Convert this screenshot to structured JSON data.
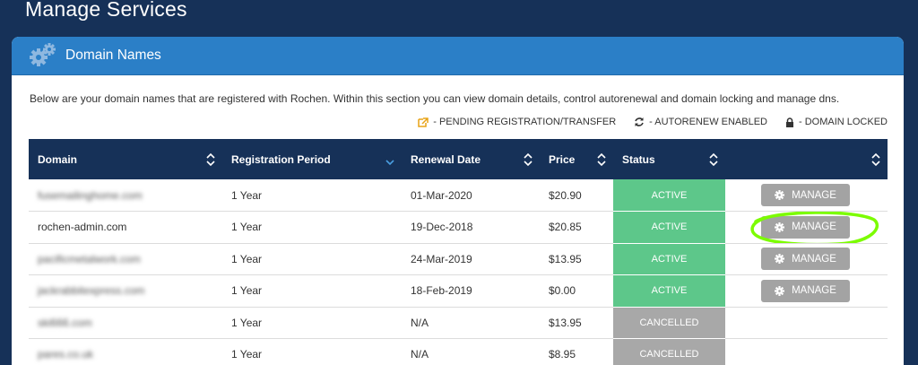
{
  "page": {
    "title": "Manage Services"
  },
  "panel": {
    "title": "Domain Names",
    "intro": "Below are your domain names that are registered with Rochen. Within this section you can view domain details, control autorenewal and domain locking and manage dns."
  },
  "legend": {
    "pending": "- PENDING REGISTRATION/TRANSFER",
    "autorenew": "- AUTORENEW ENABLED",
    "locked": "- DOMAIN LOCKED"
  },
  "table": {
    "headers": [
      "Domain",
      "Registration Period",
      "Renewal Date",
      "Price",
      "Status",
      ""
    ],
    "manage_label": "MANAGE",
    "rows": [
      {
        "domain": "fusemailinghome.com",
        "period": "1 Year",
        "renewal": "01-Mar-2020",
        "price": "$20.90",
        "status": "ACTIVE"
      },
      {
        "domain": "rochen-admin.com",
        "period": "1 Year",
        "renewal": "19-Dec-2018",
        "price": "$20.85",
        "status": "ACTIVE"
      },
      {
        "domain": "pacificmetalwork.com",
        "period": "1 Year",
        "renewal": "24-Mar-2019",
        "price": "$13.95",
        "status": "ACTIVE"
      },
      {
        "domain": "jackrabbitexpress.com",
        "period": "1 Year",
        "renewal": "18-Feb-2019",
        "price": "$0.00",
        "status": "ACTIVE"
      },
      {
        "domain": "ski666.com",
        "period": "1 Year",
        "renewal": "N/A",
        "price": "$13.95",
        "status": "CANCELLED"
      },
      {
        "domain": "pares.co.uk",
        "period": "1 Year",
        "renewal": "N/A",
        "price": "$8.95",
        "status": "CANCELLED"
      }
    ]
  },
  "colors": {
    "active": "#5dc78a",
    "cancelled": "#a8a8a8",
    "header_bg": "#163158",
    "panel_header": "#2b7fc7",
    "highlight": "#7cfc00"
  }
}
